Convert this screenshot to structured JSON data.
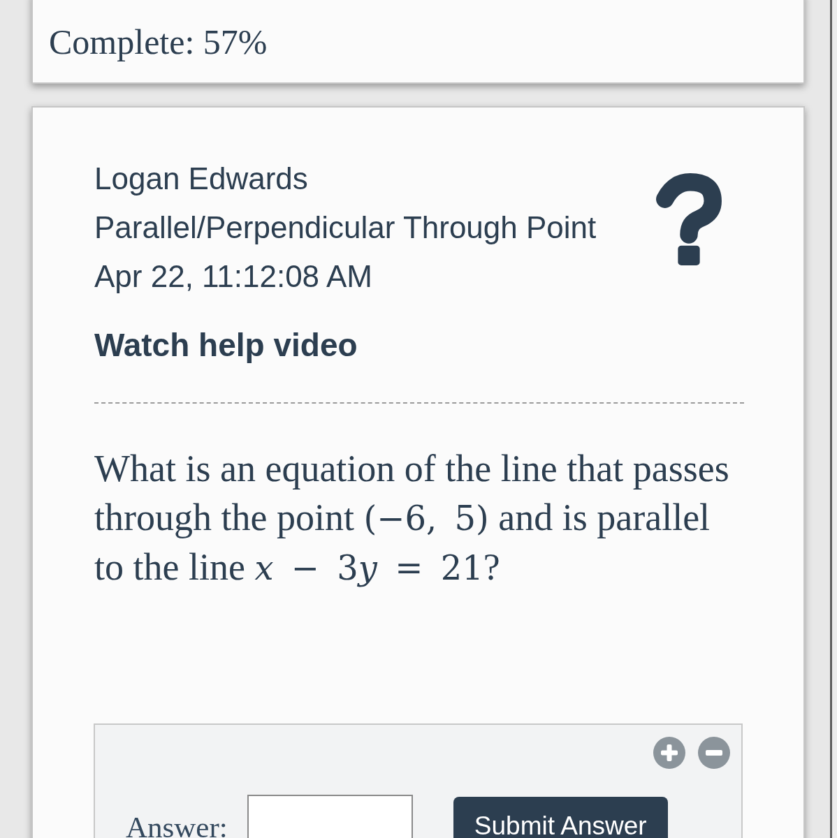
{
  "status_card": {
    "complete": "Complete: 57%"
  },
  "problem_card": {
    "student": "Logan Edwards",
    "assignment": "Parallel/Perpendicular Through Point",
    "timestamp": "Apr 22, 11:12:08 AM",
    "help_link": "Watch help video",
    "question": [
      {
        "kind": "text",
        "text": "What is an equation of the line that passes through the point "
      },
      {
        "kind": "math",
        "text": "(−6, 5)"
      },
      {
        "kind": "text",
        "text": " and is parallel to the line "
      },
      {
        "kind": "var",
        "text": "x"
      },
      {
        "kind": "math",
        "text": " − 3"
      },
      {
        "kind": "var",
        "text": "y"
      },
      {
        "kind": "math",
        "text": " = 21"
      },
      {
        "kind": "text",
        "text": "?"
      }
    ],
    "answer": {
      "label": "Answer:",
      "submit_button": "Submit Answer"
    }
  }
}
